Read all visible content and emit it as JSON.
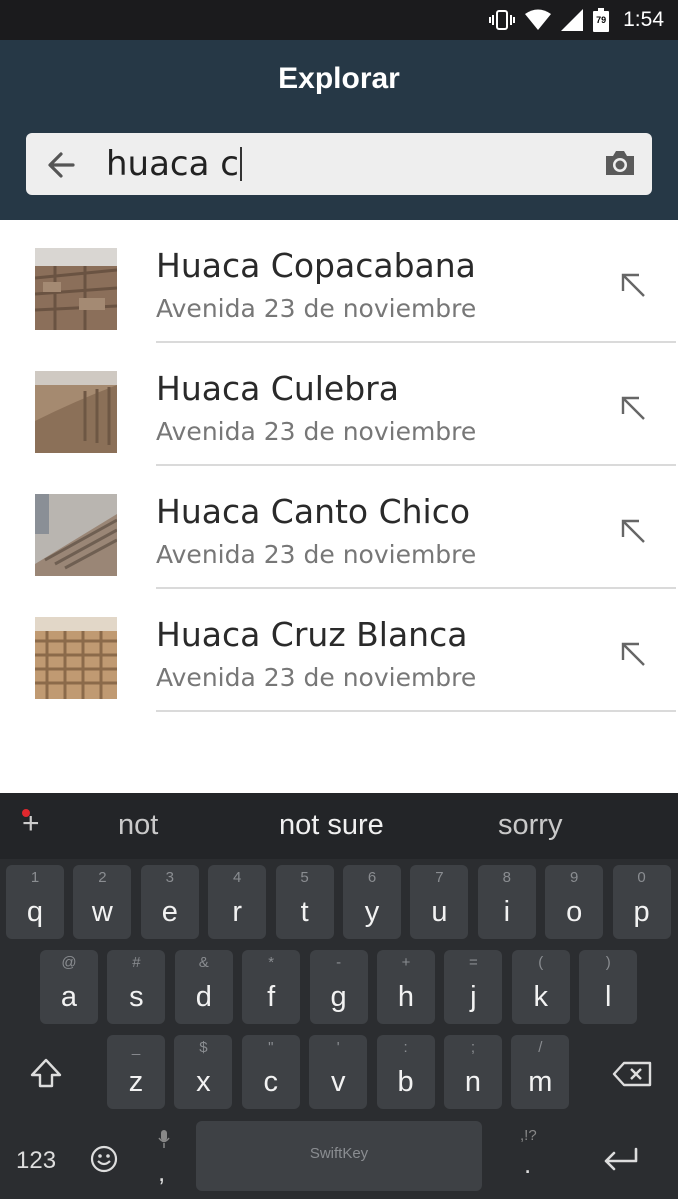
{
  "status_bar": {
    "time": "1:54",
    "battery": "79"
  },
  "app_bar": {
    "title": "Explorar"
  },
  "search": {
    "query": "huaca c"
  },
  "results": [
    {
      "title": "Huaca Copacabana",
      "subtitle": "Avenida 23 de noviembre"
    },
    {
      "title": "Huaca Culebra",
      "subtitle": "Avenida 23 de noviembre"
    },
    {
      "title": "Huaca Canto Chico",
      "subtitle": "Avenida 23 de noviembre"
    },
    {
      "title": "Huaca Cruz Blanca",
      "subtitle": "Avenida 23 de noviembre"
    }
  ],
  "keyboard": {
    "suggestions": [
      "not",
      "not sure",
      "sorry"
    ],
    "row1": [
      {
        "k": "q",
        "h": "1"
      },
      {
        "k": "w",
        "h": "2"
      },
      {
        "k": "e",
        "h": "3"
      },
      {
        "k": "r",
        "h": "4"
      },
      {
        "k": "t",
        "h": "5"
      },
      {
        "k": "y",
        "h": "6"
      },
      {
        "k": "u",
        "h": "7"
      },
      {
        "k": "i",
        "h": "8"
      },
      {
        "k": "o",
        "h": "9"
      },
      {
        "k": "p",
        "h": "0"
      }
    ],
    "row2": [
      {
        "k": "a",
        "h": "@"
      },
      {
        "k": "s",
        "h": "#"
      },
      {
        "k": "d",
        "h": "&"
      },
      {
        "k": "f",
        "h": "*"
      },
      {
        "k": "g",
        "h": "-"
      },
      {
        "k": "h",
        "h": "+"
      },
      {
        "k": "j",
        "h": "="
      },
      {
        "k": "k",
        "h": "("
      },
      {
        "k": "l",
        "h": ")"
      }
    ],
    "row3": [
      {
        "k": "z",
        "h": "_"
      },
      {
        "k": "x",
        "h": "$"
      },
      {
        "k": "c",
        "h": "\""
      },
      {
        "k": "v",
        "h": "'"
      },
      {
        "k": "b",
        "h": ":"
      },
      {
        "k": "n",
        "h": ";"
      },
      {
        "k": "m",
        "h": "/"
      }
    ],
    "numbers_label": "123",
    "space_label": "SwiftKey",
    "comma": ",",
    "period": ".",
    "period_hint": ",!?"
  }
}
